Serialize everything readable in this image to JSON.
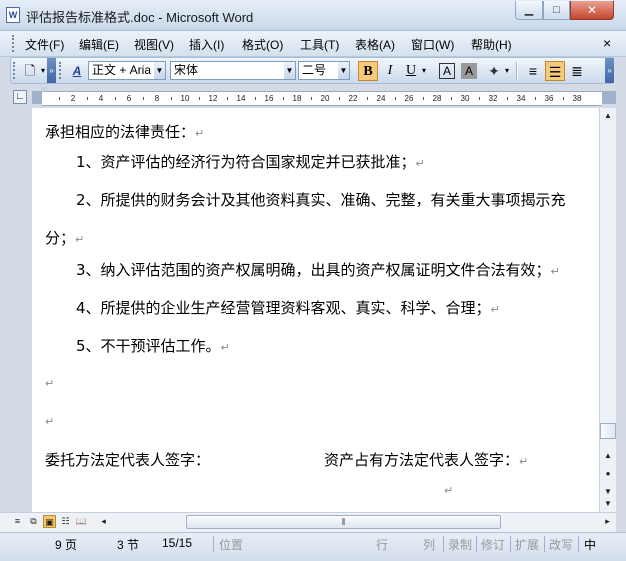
{
  "window": {
    "title": "评估报告标准格式.doc - Microsoft Word",
    "icon_name": "word-doc-icon",
    "min_label": "▭",
    "max_label": "□",
    "close_label": "✕"
  },
  "menu": {
    "items": [
      {
        "label": "文件(F)"
      },
      {
        "label": "编辑(E)"
      },
      {
        "label": "视图(V)"
      },
      {
        "label": "插入(I)"
      },
      {
        "label": "格式(O)"
      },
      {
        "label": "工具(T)"
      },
      {
        "label": "表格(A)"
      },
      {
        "label": "窗口(W)"
      },
      {
        "label": "帮助(H)"
      }
    ],
    "close_label": "×"
  },
  "toolbar": {
    "style_value": "正文 + Aria",
    "font_value": "宋体",
    "size_value": "二号",
    "bold_label": "B",
    "italic_label": "I",
    "underline_label": "U",
    "char_border_label": "A",
    "char_shade_label": "A",
    "bold_active": true,
    "center_active": true
  },
  "ruler": {
    "ticks": [
      "2",
      "4",
      "6",
      "8",
      "10",
      "12",
      "14",
      "16",
      "18",
      "20",
      "22",
      "24",
      "26",
      "28",
      "30",
      "32",
      "34",
      "36",
      "38"
    ]
  },
  "document": {
    "lines": [
      {
        "text": "承担相应的法律责任：",
        "mark": "↵"
      },
      {
        "text": "1、资产评估的经济行为符合国家规定并已获批准；",
        "mark": "↵"
      },
      {
        "text": "2、所提供的财务会计及其他资料真实、准确、完整，有关重大事项揭示充",
        "mark": ""
      },
      {
        "text": "分；",
        "mark": "↵"
      },
      {
        "text": "3、纳入评估范围的资产权属明确，出具的资产权属证明文件合法有效；",
        "mark": "↵"
      },
      {
        "text": "4、所提供的企业生产经营管理资料客观、真实、科学、合理；",
        "mark": "↵"
      },
      {
        "text": "5、不干预评估工作。",
        "mark": "↵"
      },
      {
        "text": "",
        "mark": "↵"
      },
      {
        "text": "",
        "mark": "↵"
      },
      {
        "text": "委托方法定代表人签字：",
        "mark": ""
      },
      {
        "text": "资产占有方法定代表人签字：",
        "mark": "↵"
      },
      {
        "text": "",
        "mark": "↵"
      }
    ]
  },
  "status": {
    "page": "9 页",
    "section": "3 节",
    "page_count": "15/15",
    "position": "位置",
    "line": "行",
    "column": "列",
    "rec": "录制",
    "trk": "修订",
    "ext": "扩展",
    "ovr": "改写",
    "lang": "中"
  }
}
